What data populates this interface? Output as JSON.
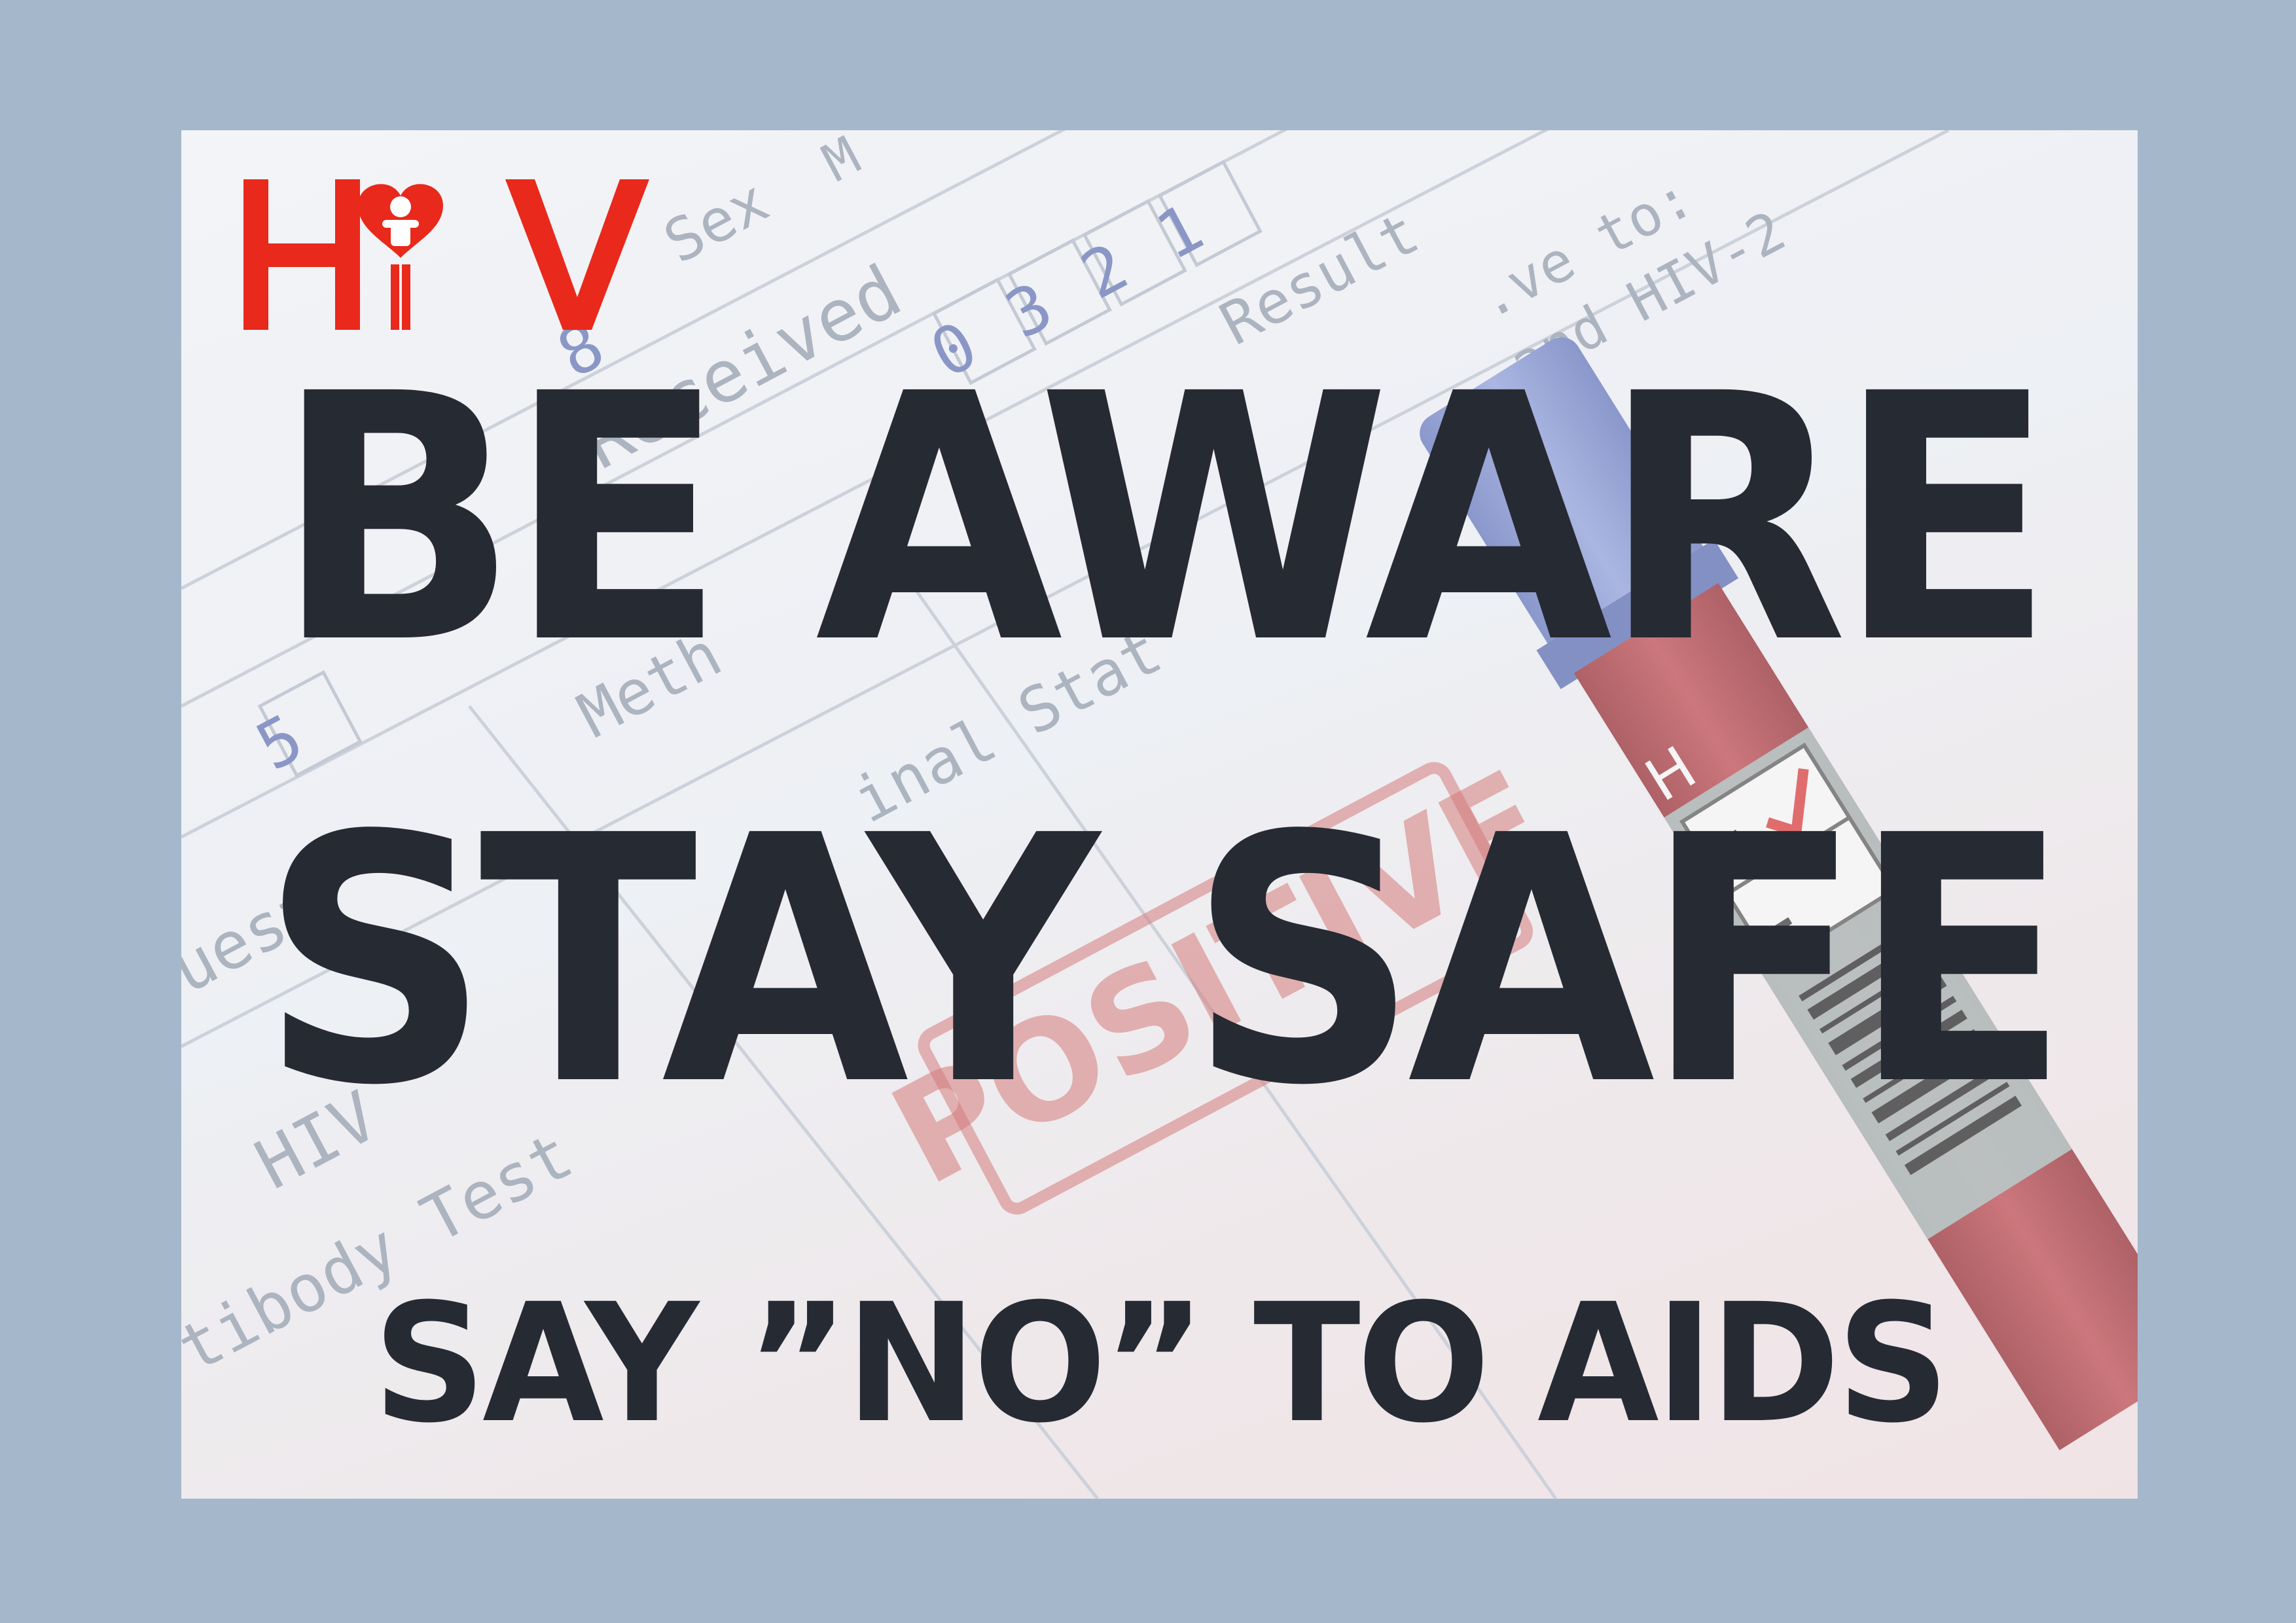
{
  "logo": {
    "text": "HIV",
    "color": "#e8291c",
    "icon": "person-heart-icon"
  },
  "headline": {
    "line1": "BE AWARE",
    "line2": "STAY SAFE",
    "line3": "SAY ”NO”  TO AIDS"
  },
  "background": {
    "form_labels": {
      "sex": "Sex",
      "sex_value": "M",
      "received": "Received",
      "result": "Result",
      "method": "Meth",
      "status": "inal Stat",
      "request": "uest",
      "hiv": "HIV",
      "antibody": "tibody Test",
      "ve_to": ".ve to:",
      "and_hiv2": "and HIV-2"
    },
    "form_digits": [
      "0",
      "3",
      "2",
      "1",
      "8",
      "5"
    ],
    "stamp_text": "POSITIVE",
    "tube_letter": "H",
    "tube_plus": "+",
    "tube_minus": "–",
    "colors": {
      "form_text": "#8d97a8",
      "stamp": "#c44a4a",
      "tube_cap": "#6d7fc4",
      "tube_body": "#a8333a"
    }
  },
  "colors": {
    "frame": "#a5b8cb",
    "headline": "#262a33"
  }
}
